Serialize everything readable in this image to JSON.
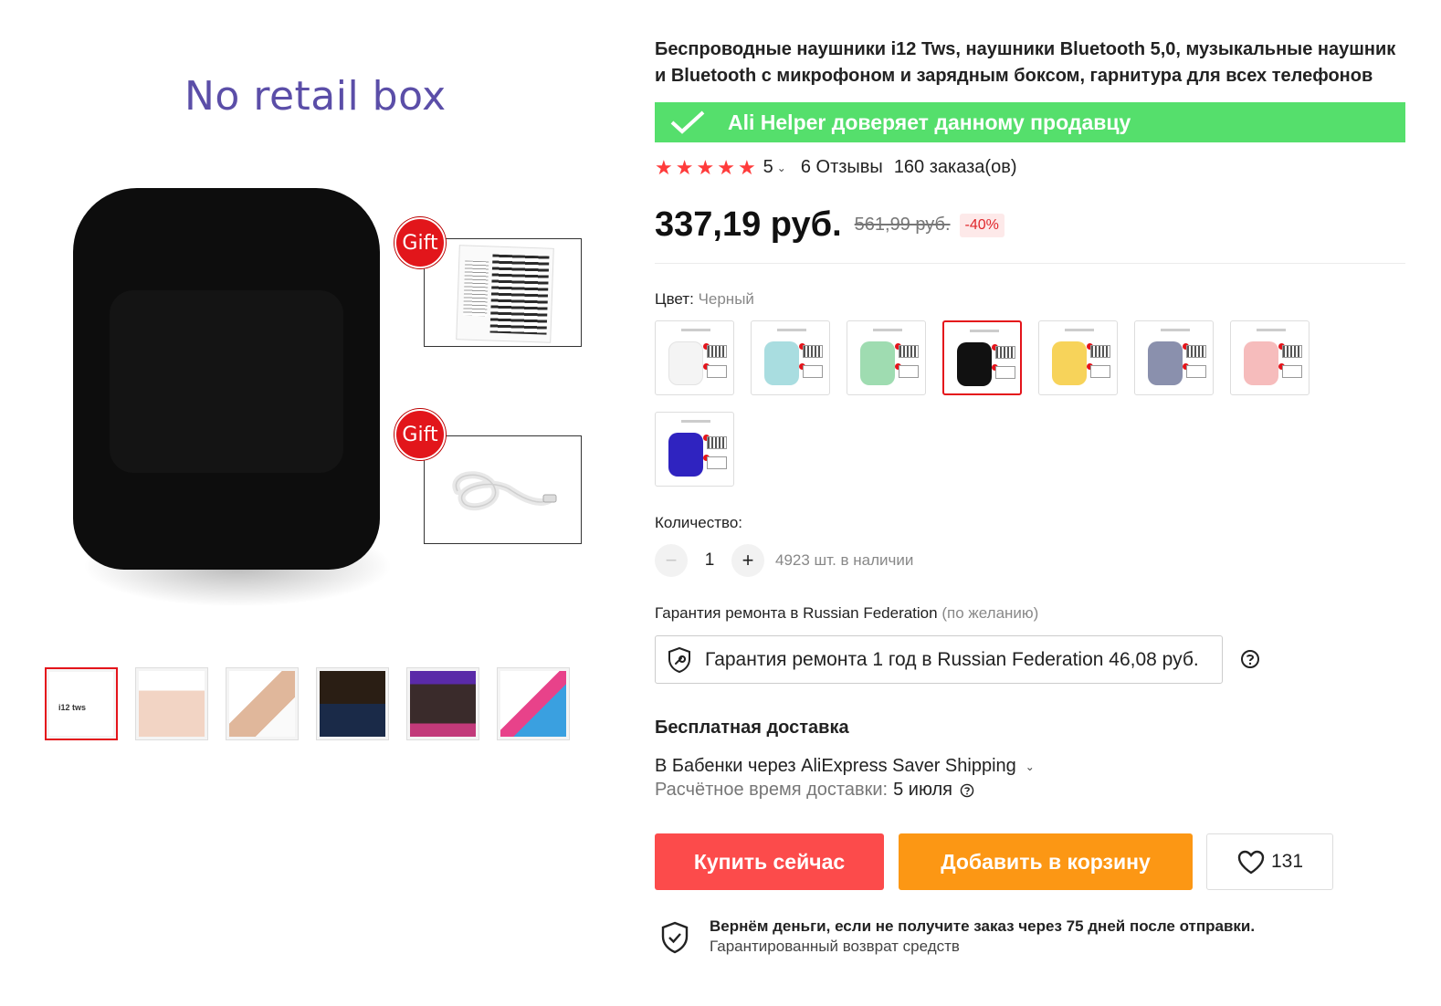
{
  "gallery": {
    "banner_text": "No retail box",
    "gift_label_1": "Gift",
    "gift_label_2": "Gift",
    "thumb_1_label": "i12 tws"
  },
  "product": {
    "title_line_1": "Беспроводные наушники i12 Tws, наушники Bluetooth 5,0, музыкальные наушник",
    "title_line_2": "и Bluetooth с микрофоном и зарядным боксом, гарнитура для всех телефонов",
    "helper_text": "Ali Helper доверяет данному продавцу",
    "helper_color": "#55df6c",
    "rating": "5",
    "stars_count": 5,
    "reviews": "6 Отзывы",
    "orders": "160 заказа(ов)",
    "price": "337,19 руб.",
    "old_price": "561,99 руб.",
    "discount": "-40%"
  },
  "color": {
    "label": "Цвет:",
    "selected_value": "Черный",
    "options": [
      {
        "color": "#f4f4f4",
        "selected": false
      },
      {
        "color": "#a9dde0",
        "selected": false
      },
      {
        "color": "#9fdcb1",
        "selected": false
      },
      {
        "color": "#111111",
        "selected": true
      },
      {
        "color": "#f7d35a",
        "selected": false
      },
      {
        "color": "#8a90ad",
        "selected": false
      },
      {
        "color": "#f6bcbc",
        "selected": false
      },
      {
        "color": "#2f23c0",
        "selected": false
      }
    ]
  },
  "quantity": {
    "label": "Количество:",
    "minus": "−",
    "plus": "+",
    "value": "1",
    "stock": "4923 шт. в наличии"
  },
  "warranty": {
    "label": "Гарантия ремонта в Russian Federation",
    "optional": "(по желанию)",
    "option_text": "Гарантия ремонта 1 год в Russian Federation 46,08 руб."
  },
  "shipping": {
    "title": "Бесплатная доставка",
    "via": "В Бабенки через AliExpress Saver Shipping",
    "eta_label": "Расчётное время доставки:",
    "eta_date": "5 июля"
  },
  "actions": {
    "buy_now": "Купить сейчас",
    "add_to_cart": "Добавить в корзину",
    "wishlist_count": "131",
    "buy_color": "#fc4b4b",
    "cart_color": "#fc9714"
  },
  "guarantee": {
    "main": "Вернём деньги, если не получите заказ через 75 дней после отправки.",
    "sub": "Гарантированный возврат средств"
  }
}
